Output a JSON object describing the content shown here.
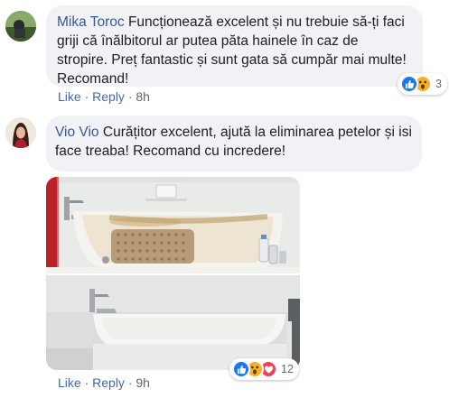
{
  "comments": [
    {
      "author": "Mika Toroc",
      "text": "Funcționează excelent și nu trebuie să-ți faci griji că înălbitorul ar putea păta hainele în caz de stropire. Preț fantastic și sunt gata să cumpăr mai multe! Recomand!",
      "like_label": "Like",
      "reply_label": "Reply",
      "time": "8h",
      "reaction_count": "3",
      "reactions": [
        "like-icon",
        "wow-icon"
      ]
    },
    {
      "author": "Vio Vio",
      "text": "Curățitor excelent, ajută la eliminarea petelor și isi face treaba! Recomand cu incredere!",
      "like_label": "Like",
      "reply_label": "Reply",
      "time": "9h",
      "reaction_count": "12",
      "reactions": [
        "like-icon",
        "wow-icon",
        "love-icon"
      ]
    }
  ],
  "separator": "·",
  "colors": {
    "link": "#385898",
    "action": "#4267b2",
    "bubble": "#f0f2f5",
    "like": "#1877f2",
    "wow": "#f7b125",
    "love": "#f33e58"
  }
}
